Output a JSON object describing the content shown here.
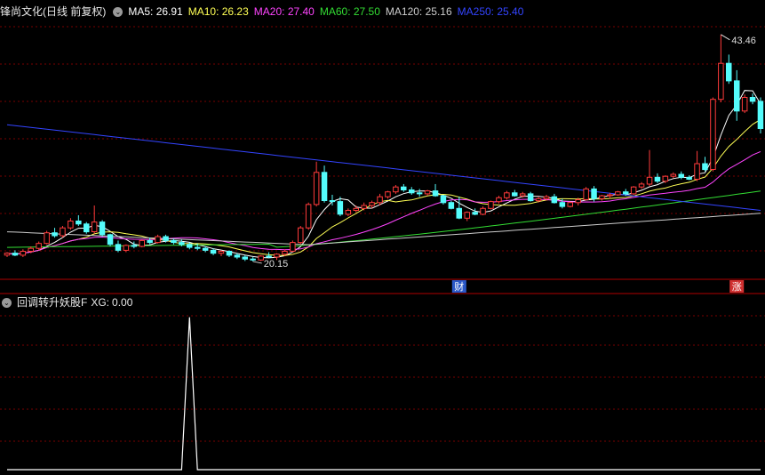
{
  "main": {
    "title": "锋尚文化(日线 前复权)",
    "ma": [
      {
        "label": "MA5:",
        "value": "26.91",
        "color": "#ffffff"
      },
      {
        "label": "MA10:",
        "value": "26.23",
        "color": "#ffff55"
      },
      {
        "label": "MA20:",
        "value": "27.40",
        "color": "#ff44ff"
      },
      {
        "label": "MA60:",
        "value": "27.50",
        "color": "#33dd33"
      },
      {
        "label": "MA120:",
        "value": "25.16",
        "color": "#cccccc"
      },
      {
        "label": "MA250:",
        "value": "25.40",
        "color": "#3344ff"
      }
    ],
    "high_label": "43.46",
    "low_label": "20.15",
    "markers": [
      {
        "text": "财",
        "bg": "#2a58c8"
      },
      {
        "text": "涨",
        "bg": "#d03030"
      }
    ]
  },
  "sub": {
    "title": "回调转升妖股F",
    "xg_label": "XG:",
    "xg_value": "0.00"
  },
  "colors": {
    "up": "#ff3b3b",
    "down": "#54fcfc",
    "grid": "#7a0000",
    "axis": "#b00000"
  },
  "chart_data": [
    {
      "type": "candlestick",
      "title": "锋尚文化(日线 前复权)",
      "ylim": [
        18.5,
        45
      ],
      "grid": true,
      "candles": [
        [
          20.8,
          21.1,
          20.6,
          21.0
        ],
        [
          21.0,
          21.3,
          20.7,
          20.8
        ],
        [
          20.8,
          21.4,
          20.6,
          21.2
        ],
        [
          21.2,
          21.7,
          21.0,
          21.5
        ],
        [
          21.5,
          22.2,
          21.3,
          22.0
        ],
        [
          22.0,
          23.3,
          21.9,
          23.1
        ],
        [
          23.1,
          23.6,
          22.6,
          22.8
        ],
        [
          22.8,
          23.8,
          22.6,
          23.6
        ],
        [
          23.6,
          24.6,
          23.4,
          24.3
        ],
        [
          24.3,
          24.9,
          23.8,
          24.0
        ],
        [
          24.0,
          24.2,
          23.0,
          23.2
        ],
        [
          23.2,
          25.9,
          23.0,
          24.2
        ],
        [
          24.2,
          24.4,
          22.7,
          22.9
        ],
        [
          22.9,
          23.0,
          21.7,
          21.9
        ],
        [
          21.9,
          22.3,
          21.1,
          21.3
        ],
        [
          21.3,
          21.9,
          21.1,
          21.8
        ],
        [
          21.8,
          22.2,
          21.5,
          21.7
        ],
        [
          21.7,
          22.4,
          21.6,
          22.3
        ],
        [
          22.3,
          22.6,
          21.9,
          22.1
        ],
        [
          22.1,
          22.9,
          22.0,
          22.7
        ],
        [
          22.7,
          22.9,
          22.1,
          22.3
        ],
        [
          22.3,
          22.5,
          21.9,
          22.1
        ],
        [
          22.1,
          22.4,
          21.7,
          21.9
        ],
        [
          21.9,
          22.1,
          21.4,
          21.6
        ],
        [
          21.6,
          22.0,
          21.3,
          21.5
        ],
        [
          21.5,
          21.7,
          21.1,
          21.3
        ],
        [
          21.3,
          21.5,
          20.8,
          21.0
        ],
        [
          21.0,
          21.3,
          20.7,
          21.2
        ],
        [
          21.2,
          21.3,
          20.6,
          20.8
        ],
        [
          20.8,
          21.0,
          20.4,
          20.6
        ],
        [
          20.6,
          20.8,
          20.2,
          20.4
        ],
        [
          20.4,
          20.6,
          20.15,
          20.3
        ],
        [
          20.3,
          20.8,
          20.2,
          20.7
        ],
        [
          20.7,
          21.1,
          20.5,
          20.6
        ],
        [
          20.6,
          21.0,
          20.3,
          20.9
        ],
        [
          20.9,
          21.4,
          20.7,
          21.2
        ],
        [
          21.2,
          22.3,
          21.1,
          22.1
        ],
        [
          22.1,
          23.8,
          21.9,
          23.6
        ],
        [
          23.6,
          26.2,
          23.4,
          26.0
        ],
        [
          26.0,
          30.4,
          25.8,
          29.3
        ],
        [
          29.3,
          30.0,
          26.2,
          26.4
        ],
        [
          26.4,
          27.0,
          25.9,
          26.3
        ],
        [
          26.3,
          26.8,
          24.8,
          25.0
        ],
        [
          25.0,
          25.6,
          24.8,
          25.4
        ],
        [
          25.4,
          25.9,
          25.2,
          25.6
        ],
        [
          25.6,
          26.2,
          25.4,
          25.9
        ],
        [
          25.9,
          26.4,
          25.6,
          26.2
        ],
        [
          26.2,
          27.1,
          25.9,
          26.8
        ],
        [
          26.8,
          27.4,
          26.6,
          27.3
        ],
        [
          27.3,
          28.0,
          27.1,
          27.8
        ],
        [
          27.8,
          28.1,
          27.3,
          27.5
        ],
        [
          27.5,
          27.8,
          27.0,
          27.2
        ],
        [
          27.2,
          27.6,
          26.8,
          27.1
        ],
        [
          27.1,
          27.5,
          26.9,
          27.4
        ],
        [
          27.4,
          28.1,
          26.8,
          26.9
        ],
        [
          26.9,
          27.0,
          26.0,
          26.2
        ],
        [
          26.2,
          26.4,
          25.5,
          25.6
        ],
        [
          25.6,
          26.8,
          24.5,
          24.6
        ],
        [
          24.6,
          25.3,
          24.3,
          25.2
        ],
        [
          25.2,
          25.6,
          24.9,
          25.0
        ],
        [
          25.0,
          25.8,
          24.9,
          25.6
        ],
        [
          25.6,
          26.4,
          25.5,
          26.3
        ],
        [
          26.3,
          26.9,
          26.1,
          26.7
        ],
        [
          26.7,
          27.4,
          26.5,
          27.2
        ],
        [
          27.2,
          27.5,
          26.8,
          26.9
        ],
        [
          26.9,
          27.3,
          26.7,
          27.1
        ],
        [
          27.1,
          27.3,
          26.3,
          26.4
        ],
        [
          26.4,
          26.8,
          26.2,
          26.6
        ],
        [
          26.6,
          27.0,
          26.4,
          26.8
        ],
        [
          26.8,
          27.1,
          26.1,
          26.2
        ],
        [
          26.2,
          26.6,
          25.6,
          25.8
        ],
        [
          25.8,
          26.3,
          25.7,
          26.2
        ],
        [
          26.2,
          26.7,
          25.9,
          26.5
        ],
        [
          26.5,
          27.8,
          26.4,
          27.6
        ],
        [
          27.6,
          27.9,
          26.3,
          26.6
        ],
        [
          26.6,
          27.0,
          26.4,
          26.9
        ],
        [
          26.9,
          27.2,
          26.6,
          27.0
        ],
        [
          27.0,
          27.4,
          26.9,
          27.3
        ],
        [
          27.3,
          27.6,
          26.9,
          27.1
        ],
        [
          27.1,
          27.9,
          27.0,
          27.8
        ],
        [
          27.8,
          28.3,
          27.6,
          28.1
        ],
        [
          28.1,
          31.6,
          27.9,
          28.8
        ],
        [
          28.8,
          29.2,
          28.2,
          28.4
        ],
        [
          28.4,
          29.0,
          28.2,
          28.9
        ],
        [
          28.9,
          29.3,
          28.7,
          29.1
        ],
        [
          29.1,
          29.4,
          28.6,
          28.8
        ],
        [
          28.8,
          29.0,
          28.5,
          28.6
        ],
        [
          28.6,
          31.5,
          28.4,
          30.2
        ],
        [
          30.2,
          30.9,
          29.4,
          29.6
        ],
        [
          29.6,
          37.0,
          29.4,
          36.8
        ],
        [
          36.8,
          43.46,
          36.5,
          40.5
        ],
        [
          40.5,
          41.4,
          38.4,
          38.7
        ],
        [
          38.7,
          39.8,
          34.6,
          35.6
        ],
        [
          35.6,
          37.3,
          35.4,
          37.0
        ],
        [
          37.0,
          37.4,
          36.3,
          36.6
        ],
        [
          36.6,
          37.0,
          33.3,
          33.8
        ]
      ],
      "ma_current": {
        "MA5": 26.91,
        "MA10": 26.23,
        "MA20": 27.4,
        "MA60": 27.5,
        "MA120": 25.16,
        "MA250": 25.4
      },
      "annotations": [
        {
          "text": "43.46",
          "type": "high"
        },
        {
          "text": "20.15",
          "type": "low"
        }
      ]
    },
    {
      "type": "line",
      "title": "回调转升妖股F",
      "series": [
        {
          "name": "XG",
          "current": 0.0,
          "pulse_index": 23,
          "pulse_value": 1
        }
      ],
      "ylim": [
        0,
        1.05
      ],
      "grid": true
    }
  ]
}
